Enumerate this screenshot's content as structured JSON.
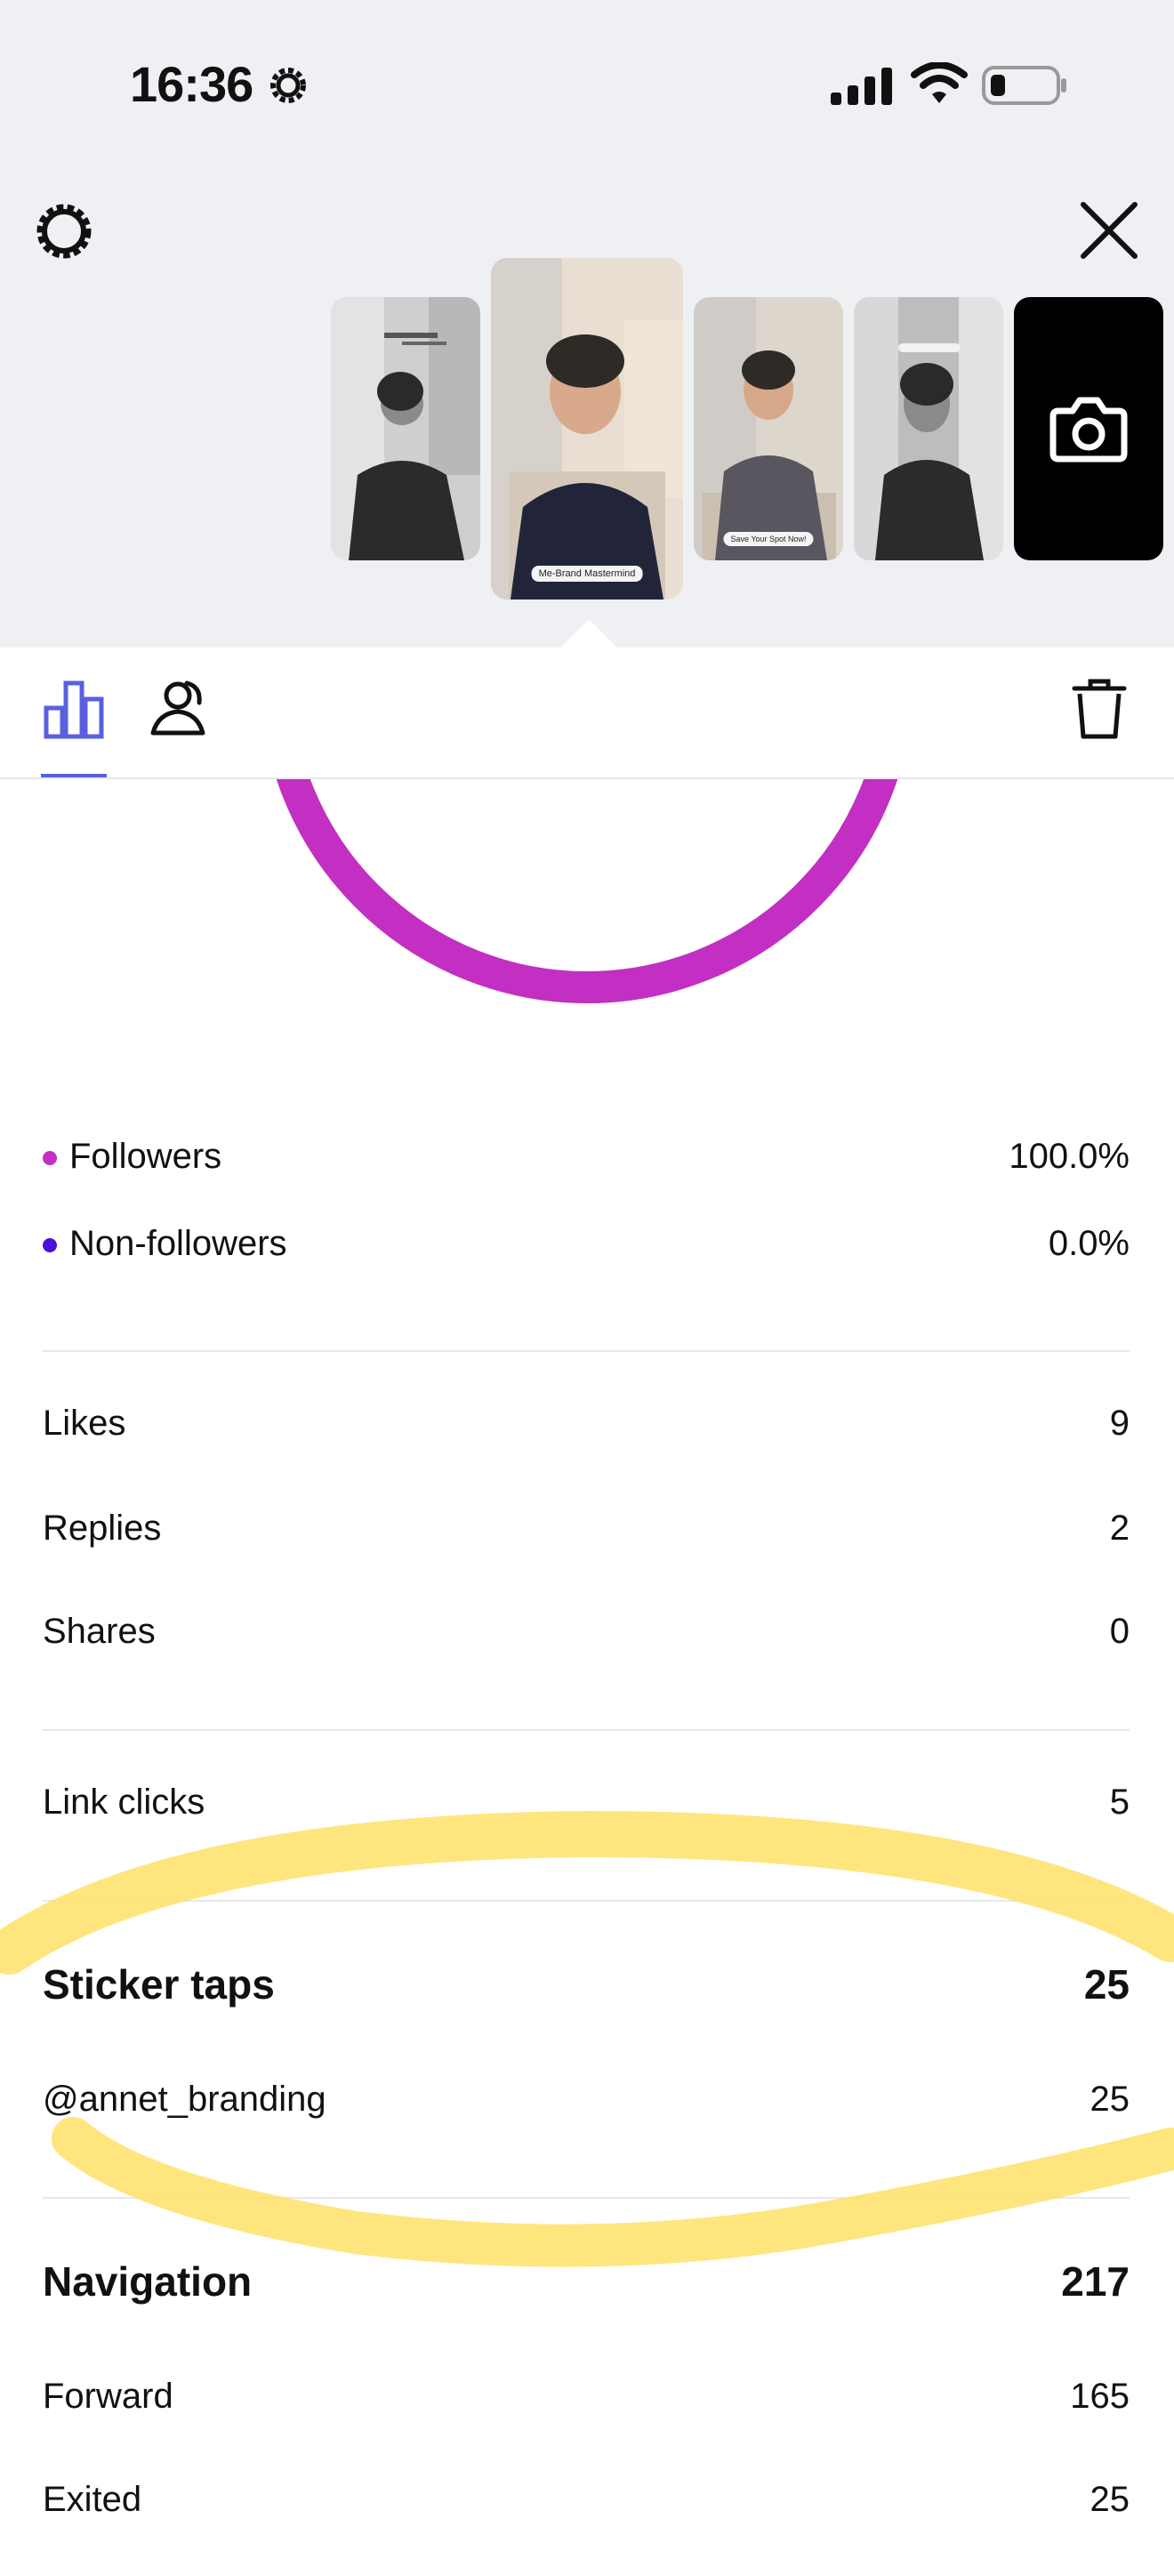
{
  "status_bar": {
    "time": "16:36"
  },
  "stories": [
    {
      "caption": "",
      "mono": true
    },
    {
      "caption": "Me-Brand Mastermind",
      "mono": false
    },
    {
      "caption": "Save Your Spot Now!",
      "mono": false
    },
    {
      "caption": "",
      "mono": true
    }
  ],
  "colors": {
    "accent": "#5a5fe0",
    "followers": "#c22fc2",
    "non_followers": "#4a12d8",
    "highlight": "#ffe066"
  },
  "chart_data": {
    "type": "pie",
    "categories": [
      "Followers",
      "Non-followers"
    ],
    "values": [
      100.0,
      0.0
    ]
  },
  "audience": {
    "followers_label": "Followers",
    "followers_value": "100.0%",
    "non_followers_label": "Non-followers",
    "non_followers_value": "0.0%"
  },
  "interactions": {
    "likes_label": "Likes",
    "likes_value": "9",
    "replies_label": "Replies",
    "replies_value": "2",
    "shares_label": "Shares",
    "shares_value": "0"
  },
  "link": {
    "label": "Link clicks",
    "value": "5"
  },
  "stickers": {
    "label": "Sticker taps",
    "value": "25",
    "item_label": "@annet_branding",
    "item_value": "25"
  },
  "navigation": {
    "label": "Navigation",
    "value": "217",
    "forward_label": "Forward",
    "forward_value": "165",
    "exited_label": "Exited",
    "exited_value": "25"
  }
}
